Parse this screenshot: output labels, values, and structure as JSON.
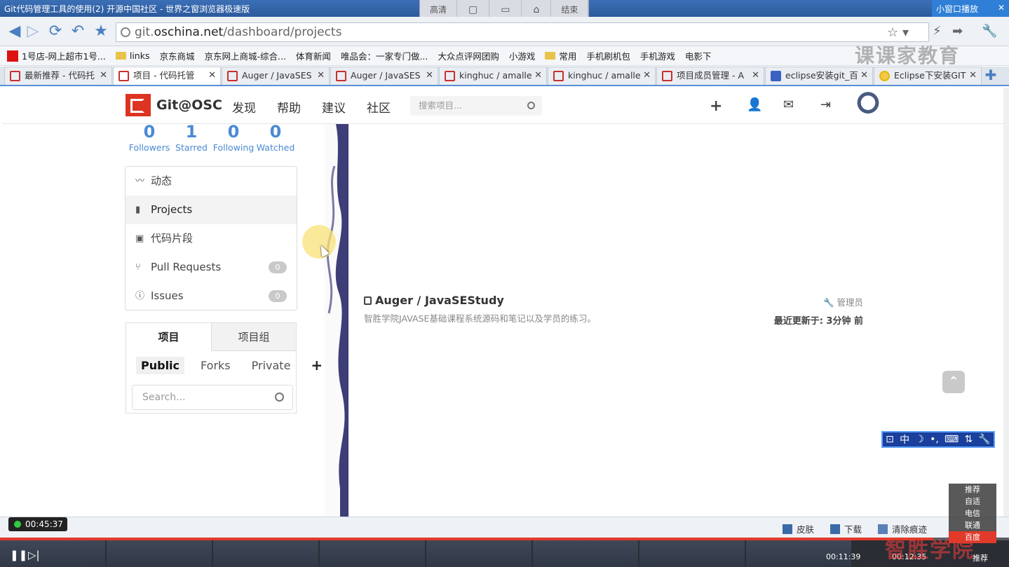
{
  "window": {
    "title": "Git代码管理工具的使用(2) 开源中国社区 - 世界之窗浏览器极速版",
    "controls": [
      "高清",
      "▢",
      "▭",
      "⌂",
      "结束"
    ],
    "mini_play": "小窗口播放",
    "close": "✕"
  },
  "nav": {
    "url_prefix": "git.",
    "url_domain": "oschina.net",
    "url_path": "/dashboard/projects"
  },
  "bookmarks": [
    {
      "type": "one",
      "label": "1号店-网上超市1号..."
    },
    {
      "type": "folder",
      "label": "links"
    },
    {
      "type": "page",
      "label": "京东商城"
    },
    {
      "type": "page",
      "label": "京东网上商城-综合..."
    },
    {
      "type": "page",
      "label": "体育新闻"
    },
    {
      "type": "page",
      "label": "唯品会：一家专门做..."
    },
    {
      "type": "page",
      "label": "大众点评网团购"
    },
    {
      "type": "page",
      "label": "小游戏"
    },
    {
      "type": "folder",
      "label": "常用"
    },
    {
      "type": "page",
      "label": "手机刷机包"
    },
    {
      "type": "page",
      "label": "手机游戏"
    },
    {
      "type": "page",
      "label": "电影下"
    }
  ],
  "watermark_top": "课课家教育",
  "tabs": [
    {
      "label": "最新推荐 - 代码托",
      "icon": "osc",
      "active": false
    },
    {
      "label": "项目 - 代码托管",
      "icon": "osc",
      "active": true
    },
    {
      "label": "Auger / JavaSES",
      "icon": "osc",
      "active": false
    },
    {
      "label": "Auger / JavaSES",
      "icon": "osc",
      "active": false
    },
    {
      "label": "kinghuc / amalle",
      "icon": "osc",
      "active": false
    },
    {
      "label": "kinghuc / amalle",
      "icon": "osc",
      "active": false
    },
    {
      "label": "项目成员管理 - A",
      "icon": "osc",
      "active": false
    },
    {
      "label": "eclipse安装git_百",
      "icon": "paw",
      "active": false
    },
    {
      "label": "Eclipse下安装GIT",
      "icon": "shield",
      "active": false
    }
  ],
  "site": {
    "logo": "Git@OSC",
    "nav": [
      "发现",
      "帮助",
      "建议",
      "社区"
    ],
    "search_placeholder": "搜索项目..."
  },
  "stats": [
    {
      "n": "0",
      "l": "Followers"
    },
    {
      "n": "1",
      "l": "Starred"
    },
    {
      "n": "0",
      "l": "Following"
    },
    {
      "n": "0",
      "l": "Watched"
    }
  ],
  "sidemenu": [
    {
      "label": "动态",
      "icon": "rss-icon",
      "glyph": ")",
      "count": null,
      "active": false
    },
    {
      "label": "Projects",
      "icon": "book-icon",
      "glyph": "▮",
      "count": null,
      "active": true
    },
    {
      "label": "代码片段",
      "icon": "code-icon",
      "glyph": "▣",
      "count": null,
      "active": false
    },
    {
      "label": "Pull Requests",
      "icon": "pull-request-icon",
      "glyph": "⑂",
      "count": "0",
      "active": false
    },
    {
      "label": "Issues",
      "icon": "info-icon",
      "glyph": "ⓘ",
      "count": "0",
      "active": false
    }
  ],
  "projpanel": {
    "tab_projects": "项目",
    "tab_groups": "项目组",
    "filters": [
      "Public",
      "Forks",
      "Private"
    ],
    "search_placeholder": "Search..."
  },
  "repo": {
    "name": "Auger / JavaSEStudy",
    "desc": "智胜学院JAVASE基础课程系统源码和笔记以及学员的练习。",
    "role": "管理员",
    "updated": "最近更新于: 3分钟 前"
  },
  "ime": [
    "中",
    "☽",
    "•,",
    "⌨",
    "⇅",
    "🔧"
  ],
  "status": {
    "timer": "00:45:37",
    "skin": "皮肤",
    "download": "下载",
    "clear": "清除痕迹"
  },
  "player": {
    "elapsed": "00:11:39",
    "total": "00:12:35",
    "progress": 0.925,
    "recommend": "推荐"
  },
  "quality": [
    "推荐",
    "自适",
    "电信",
    "联通",
    "百度"
  ],
  "quality_selected": 4,
  "watermark_bottom": "智胜学院"
}
